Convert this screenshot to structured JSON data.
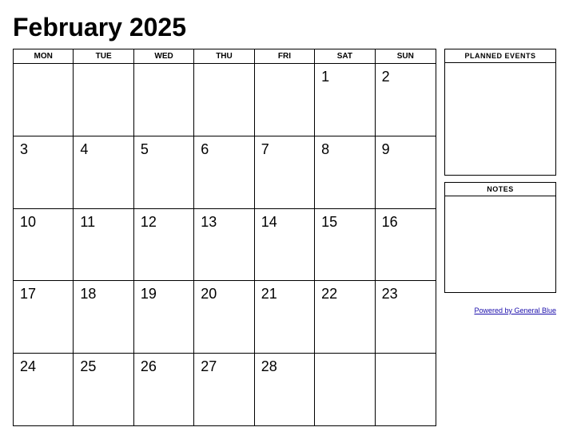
{
  "title": "February 2025",
  "days_of_week": [
    "MON",
    "TUE",
    "WED",
    "THU",
    "FRI",
    "SAT",
    "SUN"
  ],
  "weeks": [
    [
      "",
      "",
      "",
      "",
      "",
      "1",
      "2"
    ],
    [
      "3",
      "4",
      "5",
      "6",
      "7",
      "8",
      "9"
    ],
    [
      "10",
      "11",
      "12",
      "13",
      "14",
      "15",
      "16"
    ],
    [
      "17",
      "18",
      "19",
      "20",
      "21",
      "22",
      "23"
    ],
    [
      "24",
      "25",
      "26",
      "27",
      "28",
      "",
      ""
    ]
  ],
  "sidebar": {
    "planned_events_label": "PLANNED EVENTS",
    "notes_label": "NOTES"
  },
  "powered_by": {
    "text": "Powered by General Blue",
    "url": "#"
  }
}
